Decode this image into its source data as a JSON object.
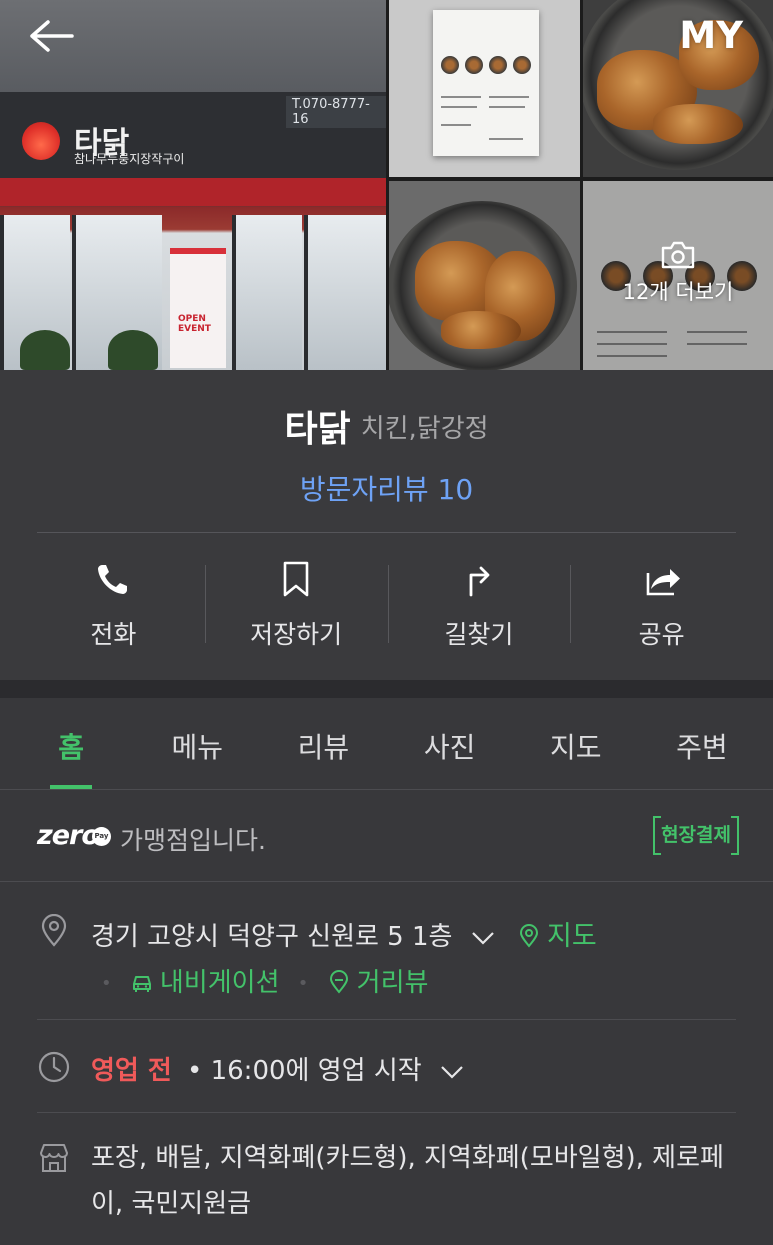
{
  "top_bar": {
    "my_label": "MY"
  },
  "gallery": {
    "sign_name": "타닭",
    "sign_sub": "참나무누룽지장작구이",
    "sign_phone": "T.070-8777-16",
    "banner_text": "OPEN EVENT",
    "more_label": "12개 더보기"
  },
  "store": {
    "name": "타닭",
    "category": "치킨,닭강정",
    "review_link": "방문자리뷰 10"
  },
  "actions": [
    {
      "label": "전화",
      "icon": "phone-icon"
    },
    {
      "label": "저장하기",
      "icon": "bookmark-icon"
    },
    {
      "label": "길찾기",
      "icon": "directions-icon"
    },
    {
      "label": "공유",
      "icon": "share-icon"
    }
  ],
  "tabs": [
    {
      "label": "홈",
      "active": true
    },
    {
      "label": "메뉴"
    },
    {
      "label": "리뷰"
    },
    {
      "label": "사진"
    },
    {
      "label": "지도"
    },
    {
      "label": "주변"
    }
  ],
  "zeropay": {
    "logo": "zero",
    "logo_badge": "Pay",
    "text": "가맹점입니다.",
    "badge": "현장결제"
  },
  "address": {
    "text": "경기 고양시 덕양구 신원로 5 1층",
    "map_link": "지도",
    "navigation_link": "내비게이션",
    "street_view_link": "거리뷰"
  },
  "hours": {
    "status": "영업 전",
    "text": "• 16:00에 영업 시작"
  },
  "services": {
    "text": "포장, 배달, 지역화폐(카드형), 지역화폐(모바일형), 제로페이, 국민지원금"
  },
  "colors": {
    "accent_green": "#43c26a",
    "link_blue": "#6ea2f5",
    "status_red": "#f05a5a",
    "background": "#38383b"
  }
}
